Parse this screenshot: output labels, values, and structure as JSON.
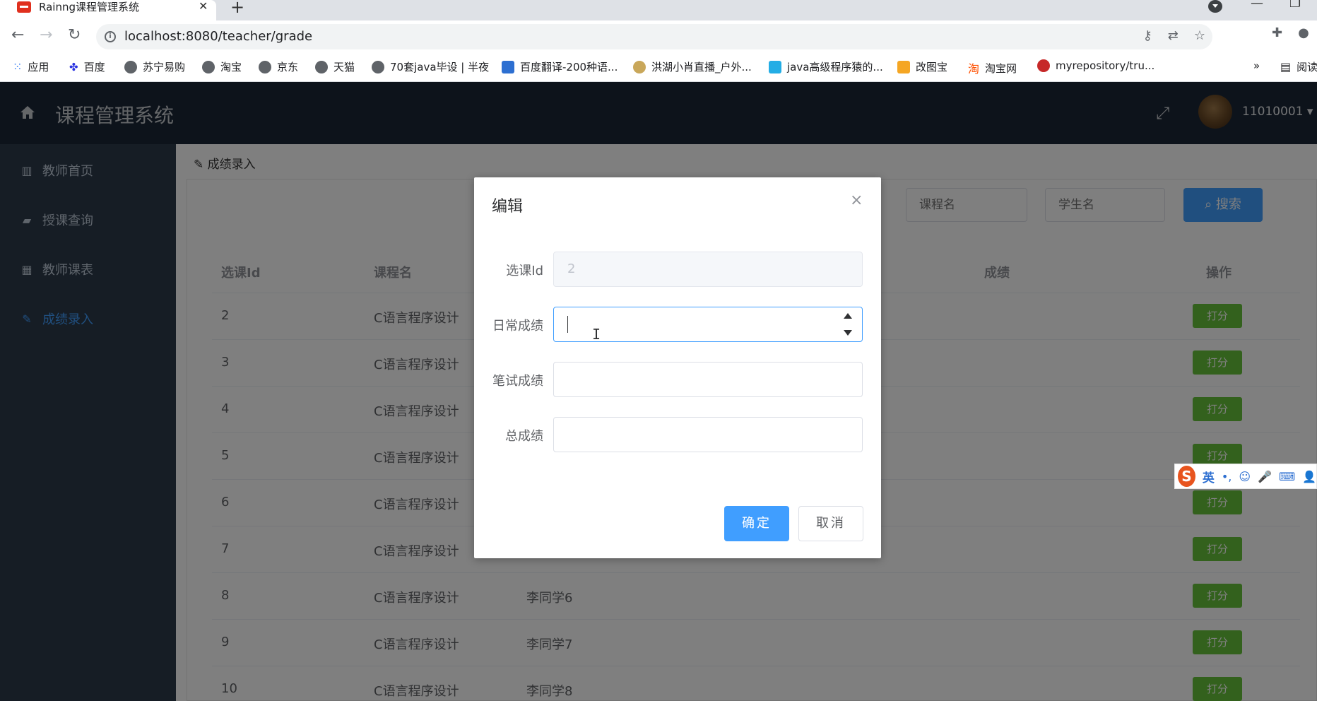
{
  "browser": {
    "tab_title": "Rainng课程管理系统",
    "tab_close": "✕",
    "new_tab": "+",
    "url": "localhost:8080/teacher/grade",
    "bookmarks": [
      {
        "label": "应用"
      },
      {
        "label": "百度"
      },
      {
        "label": "苏宁易购"
      },
      {
        "label": "淘宝"
      },
      {
        "label": "京东"
      },
      {
        "label": "天猫"
      },
      {
        "label": "70套java毕设 | 半夜"
      },
      {
        "label": "百度翻译-200种语..."
      },
      {
        "label": "洪湖小肖直播_户外..."
      },
      {
        "label": "java高级程序猿的..."
      },
      {
        "label": "改图宝"
      },
      {
        "label": "淘宝网"
      },
      {
        "label": "myrepository/tru..."
      },
      {
        "label": "阅读"
      }
    ],
    "more": "»"
  },
  "app": {
    "title": "课程管理系统",
    "user": "11010001 ▾"
  },
  "sidebar": {
    "items": [
      {
        "label": "教师首页",
        "icon": "bar-chart-icon"
      },
      {
        "label": "授课查询",
        "icon": "book-icon"
      },
      {
        "label": "教师课表",
        "icon": "table-icon"
      },
      {
        "label": "成绩录入",
        "icon": "edit-icon",
        "active": true
      }
    ]
  },
  "main": {
    "breadcrumb": "成绩录入",
    "search": {
      "course_placeholder": "课程名",
      "student_placeholder": "学生名",
      "button": "搜索"
    },
    "table": {
      "headers": [
        "选课Id",
        "课程名",
        "成绩",
        "操作"
      ],
      "rows": [
        {
          "id": "2",
          "course": "C语言程序设计",
          "student": ""
        },
        {
          "id": "3",
          "course": "C语言程序设计",
          "student": ""
        },
        {
          "id": "4",
          "course": "C语言程序设计",
          "student": ""
        },
        {
          "id": "5",
          "course": "C语言程序设计",
          "student": ""
        },
        {
          "id": "6",
          "course": "C语言程序设计",
          "student": ""
        },
        {
          "id": "7",
          "course": "C语言程序设计",
          "student": ""
        },
        {
          "id": "8",
          "course": "C语言程序设计",
          "student": "李同学6"
        },
        {
          "id": "9",
          "course": "C语言程序设计",
          "student": "李同学7"
        },
        {
          "id": "10",
          "course": "C语言程序设计",
          "student": "李同学8"
        }
      ],
      "action_label": "打分"
    }
  },
  "dialog": {
    "title": "编辑",
    "close": "×",
    "fields": [
      {
        "label": "选课Id",
        "value": "2"
      },
      {
        "label": "日常成绩",
        "value": ""
      },
      {
        "label": "笔试成绩",
        "value": ""
      },
      {
        "label": "总成绩",
        "value": ""
      }
    ],
    "ok": "确定",
    "cancel": "取消"
  },
  "ime": {
    "label": "英"
  },
  "colors": {
    "primary": "#409eff",
    "success": "#67c23a",
    "header_bg": "#1a2637",
    "sidebar_bg": "#2d3a4b"
  }
}
